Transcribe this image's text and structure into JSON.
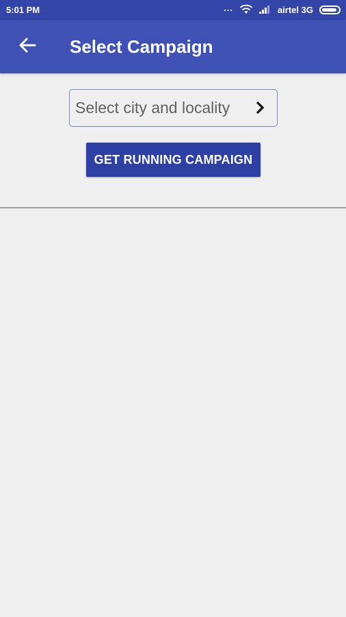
{
  "status_bar": {
    "time": "5:01 PM",
    "dots": "...",
    "carrier": "airtel 3G",
    "icons": [
      "wifi-icon",
      "signal-icon",
      "battery-icon"
    ]
  },
  "app_bar": {
    "title": "Select Campaign",
    "back_icon": "arrow-back-icon"
  },
  "form": {
    "locality_select_label": "Select city and locality",
    "locality_chevron_icon": "chevron-right-icon",
    "get_button_label": "GET RUNNING CAMPAIGN"
  },
  "colors": {
    "status_bar": "#3346a7",
    "app_bar": "#3f51b5",
    "button": "#2f40a5",
    "background": "#efefef"
  }
}
